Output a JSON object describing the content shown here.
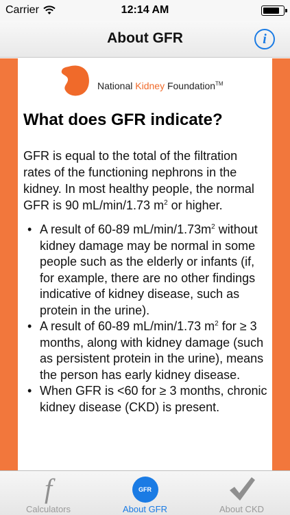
{
  "status_bar": {
    "carrier": "Carrier",
    "time": "12:14 AM",
    "battery_level": 0.85
  },
  "nav": {
    "title": "About GFR",
    "info_button": "i"
  },
  "logo": {
    "part1": "National ",
    "part2": "Kidney",
    "part3": " Foundation",
    "tm": "TM"
  },
  "content": {
    "heading": "What does GFR indicate?",
    "intro_a": "GFR is equal to the total of the filtration rates of the functioning nephrons in the kidney.  In most healthy people, the normal GFR is 90 mL/min/1.73 m",
    "intro_sup": "2",
    "intro_b": " or higher.",
    "bullet_char": "•",
    "bullets": [
      {
        "a": "A result of 60-89 mL/min/1.73m",
        "sup": "2",
        "b": " without kidney damage may be normal in some people such as the elderly or infants (if, for example, there are no other findings indicative of kidney disease, such as protein in the urine)."
      },
      {
        "a": "A result of 60-89 mL/min/1.73 m",
        "sup": "2",
        "b": " for ≥ 3 months, along with kidney damage (such as persistent protein in the urine), means the person has early kidney disease."
      },
      {
        "a": "When GFR is <60 for ≥ 3 months, chronic kidney disease (CKD) is present.",
        "sup": "",
        "b": ""
      }
    ]
  },
  "tabs": {
    "calculators": {
      "label": "Calculators",
      "icon_glyph": "f",
      "icon": "function-icon"
    },
    "about_gfr": {
      "label": "About GFR",
      "icon_text": "GFR",
      "icon": "gfr-circle-icon"
    },
    "about_ckd": {
      "label": "About CKD",
      "icon": "checkmark-icon"
    }
  },
  "colors": {
    "accent": "#1a7be4",
    "frame_orange": "#f2773c",
    "logo_orange": "#f06a2a"
  }
}
